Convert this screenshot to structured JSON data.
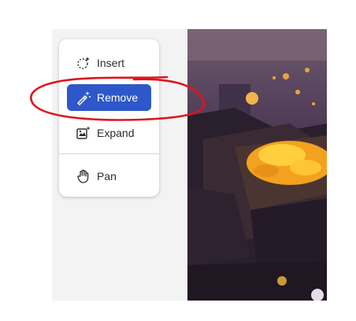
{
  "toolbar": {
    "tools": [
      {
        "label": "Insert",
        "icon": "insert-sparkle-icon",
        "active": false
      },
      {
        "label": "Remove",
        "icon": "remove-wand-icon",
        "active": true
      },
      {
        "label": "Expand",
        "icon": "expand-frame-icon",
        "active": false
      },
      {
        "label": "Pan",
        "icon": "hand-icon",
        "active": false
      }
    ]
  },
  "colors": {
    "active_tool_bg": "#2e58c9",
    "annotation_stroke": "#e0141c",
    "canvas_bg": "#f3f3f3"
  }
}
